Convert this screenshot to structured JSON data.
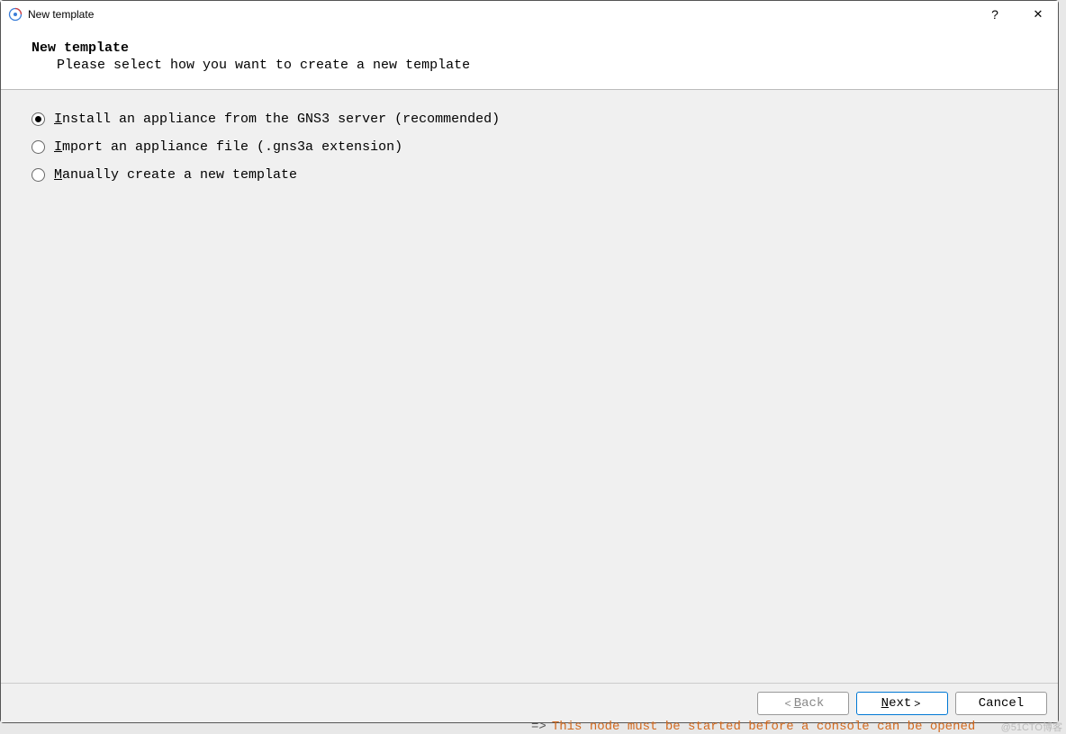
{
  "titlebar": {
    "title": "New template",
    "help": "?",
    "close": "✕"
  },
  "header": {
    "title": "New template",
    "subtitle": "Please select how you want to create a new template"
  },
  "options": [
    {
      "prefix": "I",
      "rest": "nstall an appliance from the GNS3 server (recommended)",
      "selected": true
    },
    {
      "prefix": "I",
      "rest": "mport an appliance file (.gns3a extension)",
      "selected": false
    },
    {
      "prefix": "M",
      "rest": "anually create a new template",
      "selected": false
    }
  ],
  "buttons": {
    "back_arrow": "<",
    "back_prefix": "B",
    "back_rest": "ack",
    "next_prefix": "N",
    "next_rest": "ext",
    "next_arrow": ">",
    "cancel": "Cancel"
  },
  "status": {
    "arrow": "=>",
    "text": "This node must be started before a console can be opened"
  },
  "watermark": "@51CTO博客"
}
